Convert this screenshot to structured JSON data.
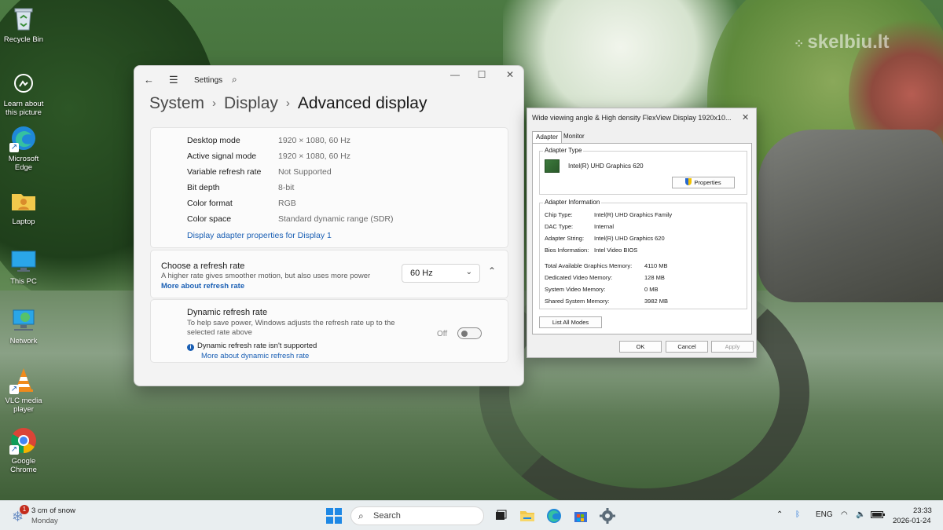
{
  "watermark": "skelbiu.lt",
  "desktop_icons": [
    {
      "label": "Recycle Bin"
    },
    {
      "label": "Learn about this picture"
    },
    {
      "label": "Microsoft Edge"
    },
    {
      "label": "Laptop"
    },
    {
      "label": "This PC"
    },
    {
      "label": "Network"
    },
    {
      "label": "VLC media player"
    },
    {
      "label": "Google Chrome"
    }
  ],
  "settings": {
    "app_title": "Settings",
    "breadcrumb": [
      "System",
      "Display",
      "Advanced display"
    ],
    "display_info": [
      {
        "label": "Desktop mode",
        "value": "1920 × 1080, 60 Hz"
      },
      {
        "label": "Active signal mode",
        "value": "1920 × 1080, 60 Hz"
      },
      {
        "label": "Variable refresh rate",
        "value": "Not Supported"
      },
      {
        "label": "Bit depth",
        "value": "8-bit"
      },
      {
        "label": "Color format",
        "value": "RGB"
      },
      {
        "label": "Color space",
        "value": "Standard dynamic range (SDR)"
      }
    ],
    "adapter_link": "Display adapter properties for Display 1",
    "refresh": {
      "title": "Choose a refresh rate",
      "subtitle": "A higher rate gives smoother motion, but also uses more power",
      "link": "More about refresh rate",
      "selected": "60 Hz"
    },
    "dynamic": {
      "title": "Dynamic refresh rate",
      "subtitle": "To help save power, Windows adjusts the refresh rate up to the selected rate above",
      "toggle_label": "Off",
      "note": "Dynamic refresh rate isn't supported",
      "link": "More about dynamic refresh rate"
    }
  },
  "dialog": {
    "title": "Wide viewing angle & High density FlexView Display 1920x10...",
    "tabs": [
      "Adapter",
      "Monitor"
    ],
    "adapter_type_label": "Adapter Type",
    "adapter_name": "Intel(R) UHD Graphics 620",
    "properties_button": "Properties",
    "adapter_info_label": "Adapter Information",
    "info": [
      {
        "label": "Chip Type:",
        "value": "Intel(R) UHD Graphics Family"
      },
      {
        "label": "DAC Type:",
        "value": "Internal"
      },
      {
        "label": "Adapter String:",
        "value": "Intel(R) UHD Graphics 620"
      },
      {
        "label": "Bios Information:",
        "value": "Intel Video BIOS"
      }
    ],
    "memory": [
      {
        "label": "Total Available Graphics Memory:",
        "value": "4110 MB"
      },
      {
        "label": "Dedicated Video Memory:",
        "value": "128 MB"
      },
      {
        "label": "System Video Memory:",
        "value": "0 MB"
      },
      {
        "label": "Shared System Memory:",
        "value": "3982 MB"
      }
    ],
    "list_modes_button": "List All Modes",
    "ok": "OK",
    "cancel": "Cancel",
    "apply": "Apply"
  },
  "taskbar": {
    "weather_badge": "1",
    "weather_text": "3 cm of snow",
    "weather_day": "Monday",
    "search_placeholder": "Search",
    "language": "ENG",
    "time": "23:33",
    "date": "2026-01-24"
  }
}
